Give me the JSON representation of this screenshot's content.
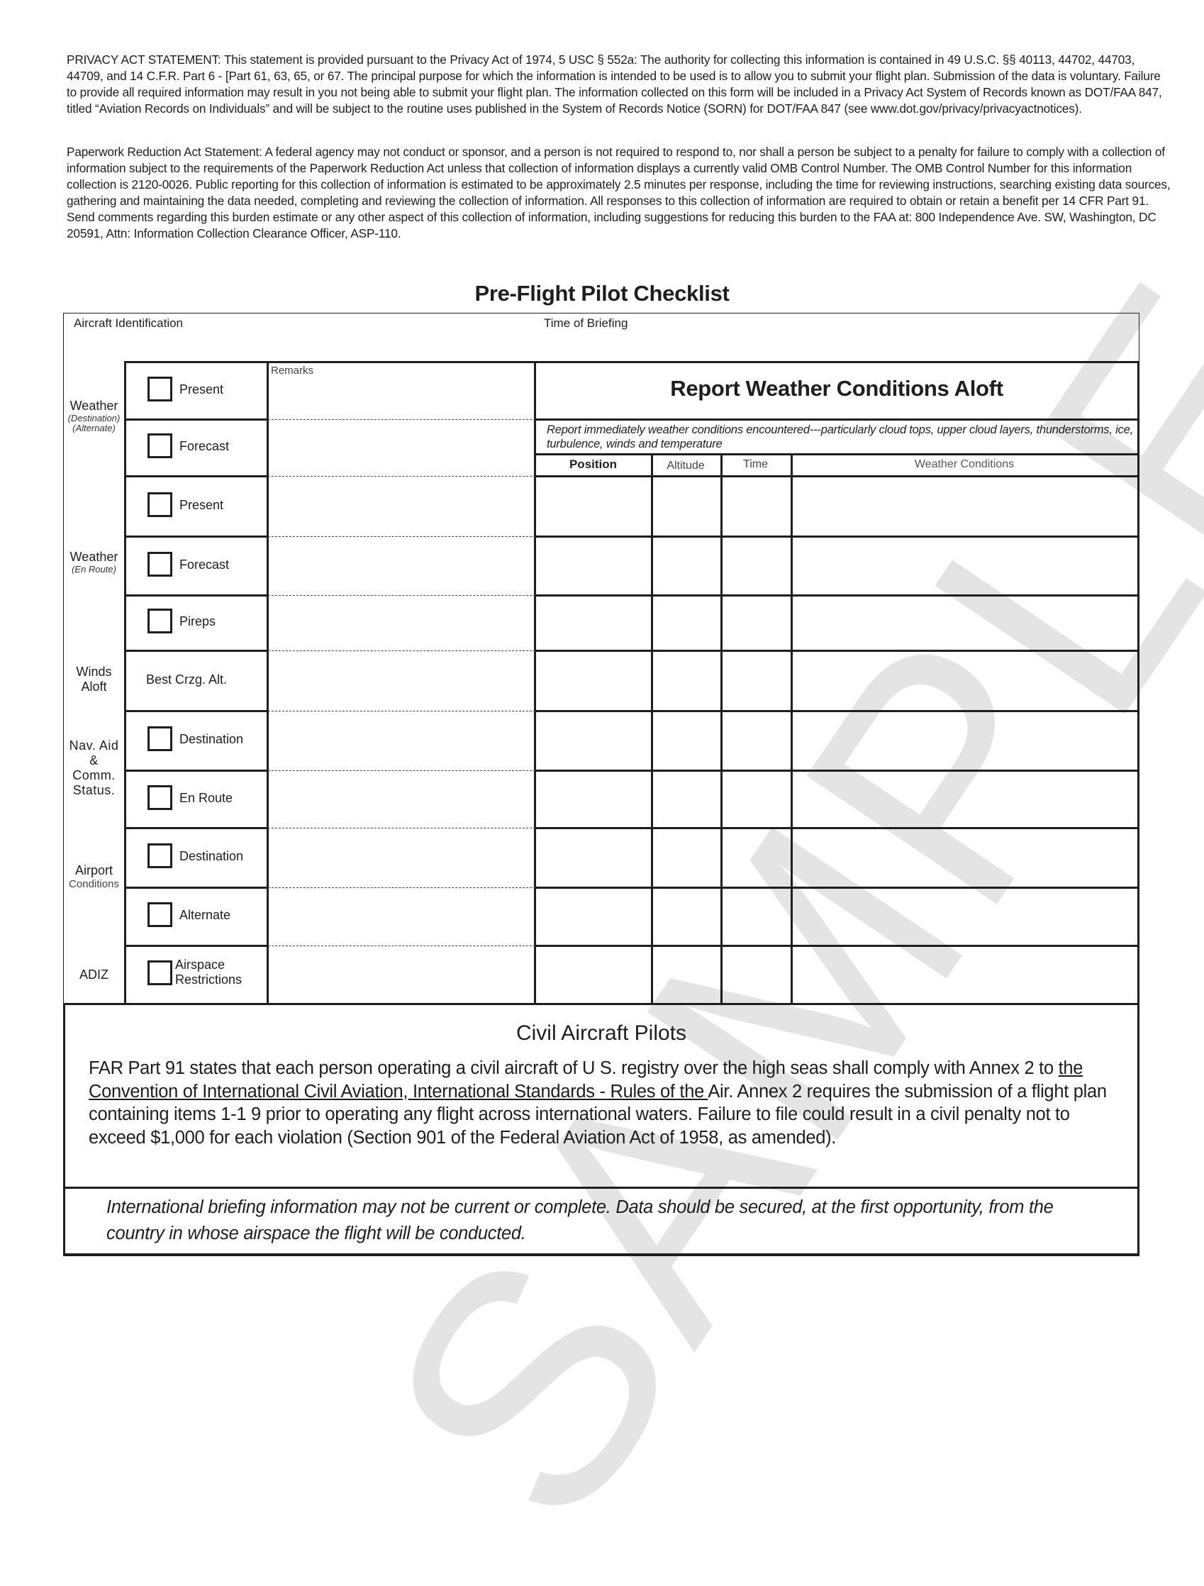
{
  "privacy_statement": "PRIVACY ACT STATEMENT: This statement is provided pursuant to the Privacy Act of 1974, 5 USC § 552a:  The authority for collecting this information is contained in 49 U.S.C. §§ 40113, 44702, 44703, 44709, and 14 C.F.R. Part 6 - [Part 61, 63, 65, or 67.  The principal purpose for which the information is intended to be used is to allow you to submit your flight plan. Submission of the data is voluntary.  Failure to provide all required information may result in you not being able to submit your flight plan.  The information collected on this form will be included in a Privacy Act System of Records known as DOT/FAA 847, titled “Aviation Records on Individuals” and will be subject to the routine uses published in the System of Records Notice (SORN) for DOT/FAA 847 (see www.dot.gov/privacy/privacyactnotices).",
  "paperwork_statement": "Paperwork Reduction Act Statement: A federal agency may not conduct or sponsor, and a person is not required to respond to, nor shall a person be subject to a penalty for failure to comply with a collection of information subject to the requirements of the Paperwork Reduction Act unless that collection of information displays a currently valid OMB Control Number.  The OMB Control Number for this information collection is 2120-0026.  Public reporting for this collection of information is estimated to be approximately 2.5 minutes per response, including the time for reviewing instructions, searching existing data sources, gathering and maintaining the data needed, completing and reviewing the collection of information.    All responses to this collection of information are required to obtain or retain a benefit per 14 CFR Part 91. Send comments regarding this burden estimate or any other aspect of this collection of information, including suggestions for reducing this burden to the FAA at: 800 Independence Ave. SW, Washington, DC 20591, Attn: Information Collection Clearance Officer, ASP-110.",
  "title": "Pre-Flight Pilot Checklist",
  "header": {
    "aircraft_identification_label": "Aircraft Identification",
    "aircraft_identification_value": "",
    "time_of_briefing_label": "Time of Briefing",
    "time_of_briefing_value": ""
  },
  "remarks_label": "Remarks",
  "categories": [
    {
      "label": "Weather",
      "sub": [
        "(Destination)",
        "(Alternate)"
      ]
    },
    {
      "label": "Weather",
      "sub": [
        "(En Route)"
      ]
    },
    {
      "label": "Winds\nAloft",
      "sub": []
    },
    {
      "label": "Nav. Aid\n&\nComm.\nStatus.",
      "sub": []
    },
    {
      "label": "Airport",
      "sub": [
        "Conditions"
      ]
    },
    {
      "label": "ADIZ",
      "sub": []
    }
  ],
  "checklist": [
    {
      "label": "Present",
      "checkbox": true,
      "checked": false,
      "remarks": ""
    },
    {
      "label": "Forecast",
      "checkbox": true,
      "checked": false,
      "remarks": ""
    },
    {
      "label": "Present",
      "checkbox": true,
      "checked": false,
      "remarks": ""
    },
    {
      "label": "Forecast",
      "checkbox": true,
      "checked": false,
      "remarks": ""
    },
    {
      "label": "Pireps",
      "checkbox": true,
      "checked": false,
      "remarks": ""
    },
    {
      "label": "Best Crzg. Alt.",
      "checkbox": false,
      "checked": false,
      "remarks": ""
    },
    {
      "label": "Destination",
      "checkbox": true,
      "checked": false,
      "remarks": ""
    },
    {
      "label": "En Route",
      "checkbox": true,
      "checked": false,
      "remarks": ""
    },
    {
      "label": "Destination",
      "checkbox": true,
      "checked": false,
      "remarks": ""
    },
    {
      "label": "Alternate",
      "checkbox": true,
      "checked": false,
      "remarks": ""
    },
    {
      "label": "Airspace\nRestrictions",
      "checkbox": true,
      "checked": false,
      "remarks": ""
    }
  ],
  "report": {
    "title": "Report Weather Conditions Aloft",
    "instructions": "Report immediately weather conditions encountered---particularly cloud tops, upper cloud layers, thunderstorms, ice, turbulence, winds and temperature",
    "columns": [
      "Position",
      "Altitude",
      "Time",
      "Weather Conditions"
    ],
    "rows": [
      [
        "",
        "",
        "",
        ""
      ],
      [
        "",
        "",
        "",
        ""
      ],
      [
        "",
        "",
        "",
        ""
      ],
      [
        "",
        "",
        "",
        ""
      ],
      [
        "",
        "",
        "",
        ""
      ],
      [
        "",
        "",
        "",
        ""
      ],
      [
        "",
        "",
        "",
        ""
      ],
      [
        "",
        "",
        "",
        ""
      ],
      [
        "",
        "",
        "",
        ""
      ]
    ]
  },
  "civil": {
    "title": "Civil Aircraft Pilots",
    "body_pre": "FAR Part 91 states that each person operating a civil aircraft of U S. registry over the high seas shall comply with Annex 2 to ",
    "body_underlined": "the Convention of International Civil Aviation, International Standards - Rules of the ",
    "body_post": "Air. Annex 2 requires the submission of a flight plan containing items 1-1 9 prior to operating any flight across international waters. Failure to file could result in a civil penalty not to exceed $1,000 for each violation (Section 901 of the Federal Aviation Act of 1958, as amended)."
  },
  "international_note": "International briefing information may not be current or complete. Data should be secured, at the first opportunity, from the country in whose airspace the flight will be conducted.",
  "watermark": "SAMPLE"
}
